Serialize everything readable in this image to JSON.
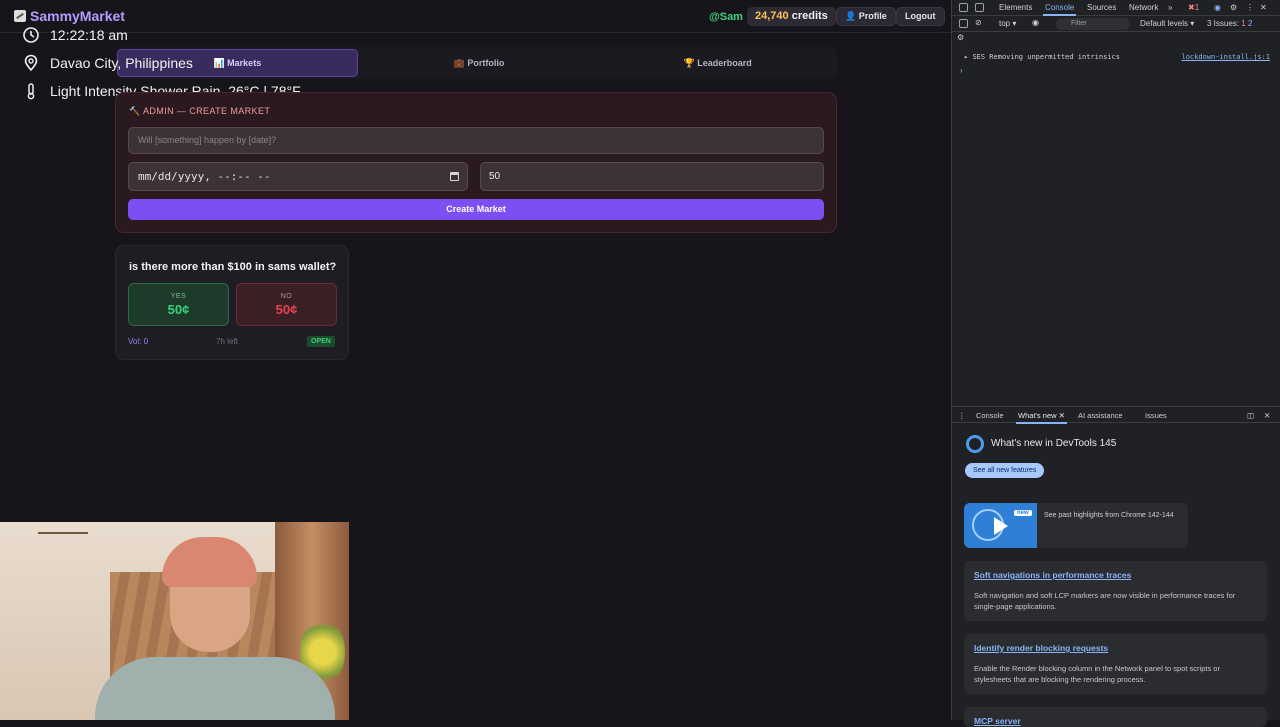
{
  "header": {
    "logo_text": "SammyMarket",
    "user_handle": "@Sam",
    "credits_value": "24,740",
    "credits_label": "credits",
    "profile_label": "👤 Profile",
    "logout_label": "Logout"
  },
  "overlay": {
    "time": "12:22:18 am",
    "location": "Davao City, Philippines",
    "weather": "Light Intensity Shower Rain, 26°C | 78°F"
  },
  "tabs": [
    {
      "label": "📊 Markets",
      "active": true
    },
    {
      "label": "💼 Portfolio",
      "active": false
    },
    {
      "label": "🏆 Leaderboard",
      "active": false
    }
  ],
  "admin": {
    "title": "🔨 ADMIN — CREATE MARKET",
    "question_placeholder": "Will [something] happen by [date]?",
    "date_placeholder": "mm/dd/yyyy, --:-- --",
    "amount_value": "50",
    "create_label": "Create Market"
  },
  "market": {
    "question": "is there more than $100 in sams wallet?",
    "yes_label": "YES",
    "yes_price": "50¢",
    "no_label": "NO",
    "no_price": "50¢",
    "volume": "Vol: 0",
    "time_left": "7h left",
    "status": "OPEN"
  },
  "devtools": {
    "tabs": [
      "Elements",
      "Console",
      "Sources",
      "Network"
    ],
    "context": "top",
    "filter_placeholder": "Filter",
    "levels": "Default levels",
    "issues": "3 Issues:",
    "issues_red": "1",
    "issues_blue": "2",
    "errors_count": "1",
    "console_message": "SES Removing unpermitted intrinsics",
    "console_source": "lockdown-install.js:1",
    "drawer_tabs": [
      "Console",
      "What's new",
      "AI assistance",
      "Issues"
    ],
    "whats_new_title": "What's new in DevTools 145",
    "see_all_label": "See all new features",
    "highlights_new": "new",
    "highlights_text": "See past highlights from Chrome 142-144",
    "cards": [
      {
        "title": "Soft navigations in performance traces",
        "body": "Soft navigation and soft LCP markers are now visible in performance traces for single-page applications."
      },
      {
        "title": "Identify render blocking requests",
        "body": "Enable the Render blocking column in the Network panel to spot scripts or stylesheets that are blocking the rendering process."
      },
      {
        "title": "MCP server",
        "body": ""
      }
    ]
  },
  "colors": {
    "accent": "#7c4ff2",
    "yes": "#34d27a",
    "no": "#e8434f",
    "credits": "#f6c453"
  }
}
